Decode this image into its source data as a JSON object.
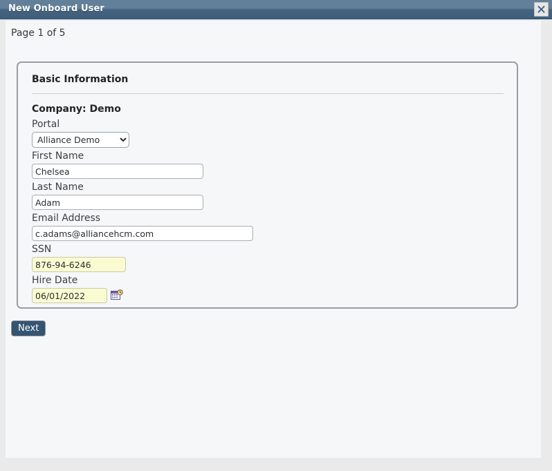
{
  "window": {
    "title": "New Onboard User",
    "close_icon": "close-icon",
    "close_label": "✖"
  },
  "page": {
    "indicator": "Page 1 of 5",
    "current_page": 1,
    "total_pages": 5
  },
  "section": {
    "heading": "Basic Information",
    "company_line": "Company: Demo"
  },
  "fields": {
    "portal": {
      "label": "Portal",
      "value": "Alliance Demo",
      "options": [
        "Alliance Demo"
      ]
    },
    "first_name": {
      "label": "First Name",
      "value": "Chelsea",
      "placeholder": ""
    },
    "last_name": {
      "label": "Last Name",
      "value": "Adam",
      "placeholder": ""
    },
    "email": {
      "label": "Email Address",
      "value": "c.adams@alliancehcm.com",
      "placeholder": ""
    },
    "ssn": {
      "label": "SSN",
      "value": "876-94-6246",
      "placeholder": ""
    },
    "hire_date": {
      "label": "Hire Date",
      "value": "06/01/2022",
      "placeholder": "",
      "picker_icon": "calendar-icon"
    }
  },
  "actions": {
    "next_label": "Next"
  },
  "colors": {
    "titlebar_top": "#63809a",
    "titlebar_bottom": "#3f5e7c",
    "panel_background": "#f5f7f9",
    "page_background": "#eaeaea",
    "button_primary": "#345473",
    "highlight_field": "#fbfbd2",
    "fieldset_border": "#9a9ea2"
  }
}
